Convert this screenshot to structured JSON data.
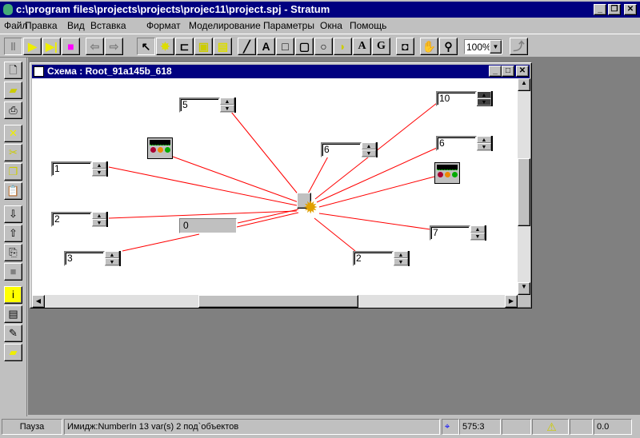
{
  "app": {
    "title": "c:\\program files\\projects\\projects\\projec11\\project.spj - Stratum"
  },
  "menu": [
    "Файл",
    "Правка",
    "Вид",
    "Вставка",
    "Формат",
    "Моделирование",
    "Параметры",
    "Окна",
    "Помощь"
  ],
  "toolbar": {
    "zoom": "100%"
  },
  "child": {
    "title": "Схема : Root_91a145b_618"
  },
  "spinners": {
    "s5": "5",
    "s10": "10",
    "s6a": "6",
    "s6b": "6",
    "s1": "1",
    "s2": "2",
    "s3": "3",
    "s7": "7",
    "s2b": "2"
  },
  "display": {
    "value": "0"
  },
  "status": {
    "mode": "Пауза",
    "info": "Имидж:NumberIn 13 var(s) 2 под`объектов",
    "coords": "575:3",
    "value": "0.0"
  },
  "colors": {
    "title": "#000080",
    "link": "#ff0000"
  }
}
